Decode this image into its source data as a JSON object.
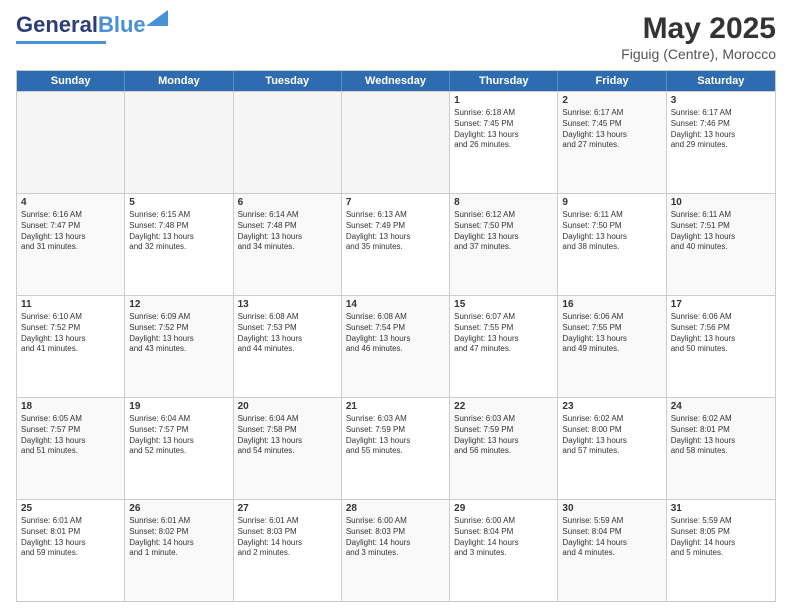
{
  "header": {
    "logo": {
      "general": "General",
      "blue": "Blue"
    },
    "title": "May 2025",
    "subtitle": "Figuig (Centre), Morocco"
  },
  "calendar": {
    "weekdays": [
      "Sunday",
      "Monday",
      "Tuesday",
      "Wednesday",
      "Thursday",
      "Friday",
      "Saturday"
    ],
    "rows": [
      [
        {
          "day": "",
          "empty": true
        },
        {
          "day": "",
          "empty": true
        },
        {
          "day": "",
          "empty": true
        },
        {
          "day": "",
          "empty": true
        },
        {
          "day": "1",
          "line1": "Sunrise: 6:18 AM",
          "line2": "Sunset: 7:45 PM",
          "line3": "Daylight: 13 hours",
          "line4": "and 26 minutes."
        },
        {
          "day": "2",
          "line1": "Sunrise: 6:17 AM",
          "line2": "Sunset: 7:45 PM",
          "line3": "Daylight: 13 hours",
          "line4": "and 27 minutes."
        },
        {
          "day": "3",
          "line1": "Sunrise: 6:17 AM",
          "line2": "Sunset: 7:46 PM",
          "line3": "Daylight: 13 hours",
          "line4": "and 29 minutes."
        }
      ],
      [
        {
          "day": "4",
          "line1": "Sunrise: 6:16 AM",
          "line2": "Sunset: 7:47 PM",
          "line3": "Daylight: 13 hours",
          "line4": "and 31 minutes."
        },
        {
          "day": "5",
          "line1": "Sunrise: 6:15 AM",
          "line2": "Sunset: 7:48 PM",
          "line3": "Daylight: 13 hours",
          "line4": "and 32 minutes."
        },
        {
          "day": "6",
          "line1": "Sunrise: 6:14 AM",
          "line2": "Sunset: 7:48 PM",
          "line3": "Daylight: 13 hours",
          "line4": "and 34 minutes."
        },
        {
          "day": "7",
          "line1": "Sunrise: 6:13 AM",
          "line2": "Sunset: 7:49 PM",
          "line3": "Daylight: 13 hours",
          "line4": "and 35 minutes."
        },
        {
          "day": "8",
          "line1": "Sunrise: 6:12 AM",
          "line2": "Sunset: 7:50 PM",
          "line3": "Daylight: 13 hours",
          "line4": "and 37 minutes."
        },
        {
          "day": "9",
          "line1": "Sunrise: 6:11 AM",
          "line2": "Sunset: 7:50 PM",
          "line3": "Daylight: 13 hours",
          "line4": "and 38 minutes."
        },
        {
          "day": "10",
          "line1": "Sunrise: 6:11 AM",
          "line2": "Sunset: 7:51 PM",
          "line3": "Daylight: 13 hours",
          "line4": "and 40 minutes."
        }
      ],
      [
        {
          "day": "11",
          "line1": "Sunrise: 6:10 AM",
          "line2": "Sunset: 7:52 PM",
          "line3": "Daylight: 13 hours",
          "line4": "and 41 minutes."
        },
        {
          "day": "12",
          "line1": "Sunrise: 6:09 AM",
          "line2": "Sunset: 7:52 PM",
          "line3": "Daylight: 13 hours",
          "line4": "and 43 minutes."
        },
        {
          "day": "13",
          "line1": "Sunrise: 6:08 AM",
          "line2": "Sunset: 7:53 PM",
          "line3": "Daylight: 13 hours",
          "line4": "and 44 minutes."
        },
        {
          "day": "14",
          "line1": "Sunrise: 6:08 AM",
          "line2": "Sunset: 7:54 PM",
          "line3": "Daylight: 13 hours",
          "line4": "and 46 minutes."
        },
        {
          "day": "15",
          "line1": "Sunrise: 6:07 AM",
          "line2": "Sunset: 7:55 PM",
          "line3": "Daylight: 13 hours",
          "line4": "and 47 minutes."
        },
        {
          "day": "16",
          "line1": "Sunrise: 6:06 AM",
          "line2": "Sunset: 7:55 PM",
          "line3": "Daylight: 13 hours",
          "line4": "and 49 minutes."
        },
        {
          "day": "17",
          "line1": "Sunrise: 6:06 AM",
          "line2": "Sunset: 7:56 PM",
          "line3": "Daylight: 13 hours",
          "line4": "and 50 minutes."
        }
      ],
      [
        {
          "day": "18",
          "line1": "Sunrise: 6:05 AM",
          "line2": "Sunset: 7:57 PM",
          "line3": "Daylight: 13 hours",
          "line4": "and 51 minutes."
        },
        {
          "day": "19",
          "line1": "Sunrise: 6:04 AM",
          "line2": "Sunset: 7:57 PM",
          "line3": "Daylight: 13 hours",
          "line4": "and 52 minutes."
        },
        {
          "day": "20",
          "line1": "Sunrise: 6:04 AM",
          "line2": "Sunset: 7:58 PM",
          "line3": "Daylight: 13 hours",
          "line4": "and 54 minutes."
        },
        {
          "day": "21",
          "line1": "Sunrise: 6:03 AM",
          "line2": "Sunset: 7:59 PM",
          "line3": "Daylight: 13 hours",
          "line4": "and 55 minutes."
        },
        {
          "day": "22",
          "line1": "Sunrise: 6:03 AM",
          "line2": "Sunset: 7:59 PM",
          "line3": "Daylight: 13 hours",
          "line4": "and 56 minutes."
        },
        {
          "day": "23",
          "line1": "Sunrise: 6:02 AM",
          "line2": "Sunset: 8:00 PM",
          "line3": "Daylight: 13 hours",
          "line4": "and 57 minutes."
        },
        {
          "day": "24",
          "line1": "Sunrise: 6:02 AM",
          "line2": "Sunset: 8:01 PM",
          "line3": "Daylight: 13 hours",
          "line4": "and 58 minutes."
        }
      ],
      [
        {
          "day": "25",
          "line1": "Sunrise: 6:01 AM",
          "line2": "Sunset: 8:01 PM",
          "line3": "Daylight: 13 hours",
          "line4": "and 59 minutes."
        },
        {
          "day": "26",
          "line1": "Sunrise: 6:01 AM",
          "line2": "Sunset: 8:02 PM",
          "line3": "Daylight: 14 hours",
          "line4": "and 1 minute."
        },
        {
          "day": "27",
          "line1": "Sunrise: 6:01 AM",
          "line2": "Sunset: 8:03 PM",
          "line3": "Daylight: 14 hours",
          "line4": "and 2 minutes."
        },
        {
          "day": "28",
          "line1": "Sunrise: 6:00 AM",
          "line2": "Sunset: 8:03 PM",
          "line3": "Daylight: 14 hours",
          "line4": "and 3 minutes."
        },
        {
          "day": "29",
          "line1": "Sunrise: 6:00 AM",
          "line2": "Sunset: 8:04 PM",
          "line3": "Daylight: 14 hours",
          "line4": "and 3 minutes."
        },
        {
          "day": "30",
          "line1": "Sunrise: 5:59 AM",
          "line2": "Sunset: 8:04 PM",
          "line3": "Daylight: 14 hours",
          "line4": "and 4 minutes."
        },
        {
          "day": "31",
          "line1": "Sunrise: 5:59 AM",
          "line2": "Sunset: 8:05 PM",
          "line3": "Daylight: 14 hours",
          "line4": "and 5 minutes."
        }
      ]
    ]
  }
}
